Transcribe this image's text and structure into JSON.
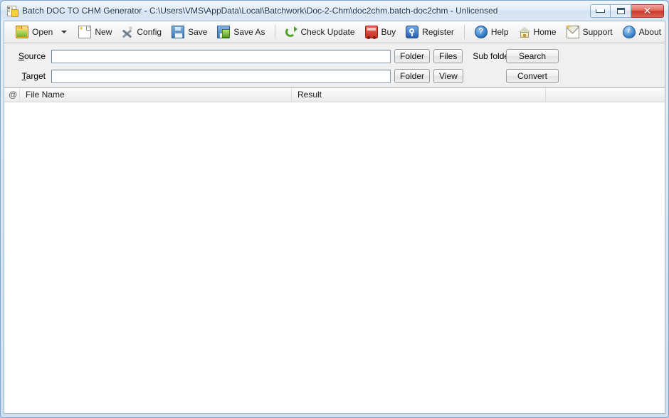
{
  "window": {
    "title": "Batch DOC TO CHM Generator - C:\\Users\\VMS\\AppData\\Local\\Batchwork\\Doc-2-Chm\\doc2chm.batch-doc2chm - Unlicensed",
    "app_icon": "app-document-icon",
    "controls": {
      "minimize": "minimize-icon",
      "maximize": "maximize-icon",
      "close": "✕"
    },
    "accent_close_color": "#c8392a",
    "frame_color": "#7ea7cc"
  },
  "toolbar": {
    "items": [
      {
        "label": "Open",
        "icon": "folder-open-icon",
        "has_dropdown": true
      },
      {
        "label": "New",
        "icon": "new-document-icon",
        "has_dropdown": false
      },
      {
        "label": "Config",
        "icon": "tools-icon",
        "has_dropdown": false
      },
      {
        "label": "Save",
        "icon": "floppy-disk-icon",
        "has_dropdown": false
      },
      {
        "label": "Save As",
        "icon": "save-as-icon",
        "has_dropdown": false
      },
      {
        "label": "Check Update",
        "icon": "refresh-icon",
        "has_dropdown": false
      },
      {
        "label": "Buy",
        "icon": "shopping-cart-icon",
        "has_dropdown": false
      },
      {
        "label": "Register",
        "icon": "register-key-icon",
        "has_dropdown": false
      },
      {
        "label": "Help",
        "icon": "help-question-icon",
        "has_dropdown": false
      },
      {
        "label": "Home",
        "icon": "home-icon",
        "has_dropdown": false
      },
      {
        "label": "Support",
        "icon": "mail-support-icon",
        "has_dropdown": false
      },
      {
        "label": "About",
        "icon": "info-icon",
        "has_dropdown": false
      }
    ]
  },
  "form": {
    "source": {
      "label_prefix": "S",
      "label_rest": "ource",
      "value": "",
      "placeholder": "",
      "folder_button": "Folder",
      "files_button": "Files"
    },
    "target": {
      "label_prefix": "T",
      "label_rest": "arget",
      "value": "",
      "placeholder": "",
      "folder_button": "Folder",
      "view_button": "View"
    },
    "sub_folders_label": "Sub folders",
    "sub_folders_checked": false,
    "search_button": "Search",
    "convert_button": "Convert"
  },
  "list": {
    "columns": [
      "@",
      "File Name",
      "Result",
      ""
    ],
    "rows": []
  }
}
